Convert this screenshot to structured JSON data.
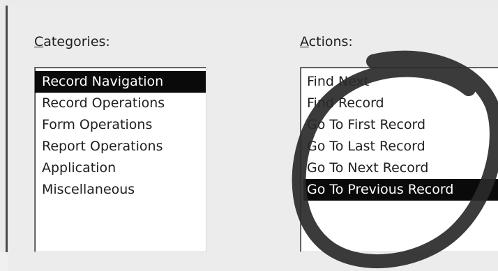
{
  "categories": {
    "label_accel": "C",
    "label_rest": "ategories:",
    "items": [
      {
        "label": "Record Navigation"
      },
      {
        "label": "Record Operations"
      },
      {
        "label": "Form Operations"
      },
      {
        "label": "Report Operations"
      },
      {
        "label": "Application"
      },
      {
        "label": "Miscellaneous"
      }
    ],
    "selected": "Record Navigation"
  },
  "actions": {
    "label_accel": "A",
    "label_rest": "ctions:",
    "items": [
      {
        "label": "Find Next"
      },
      {
        "label": "Find Record"
      },
      {
        "label": "Go To First Record"
      },
      {
        "label": "Go To Last Record"
      },
      {
        "label": "Go To Next Record"
      },
      {
        "label": "Go To Previous Record"
      }
    ],
    "selected": "Go To Previous Record"
  },
  "colors": {
    "selection_bg": "#0a0a0a",
    "selection_fg": "#ffffff",
    "annotation_stroke": "#2a2a2a"
  }
}
